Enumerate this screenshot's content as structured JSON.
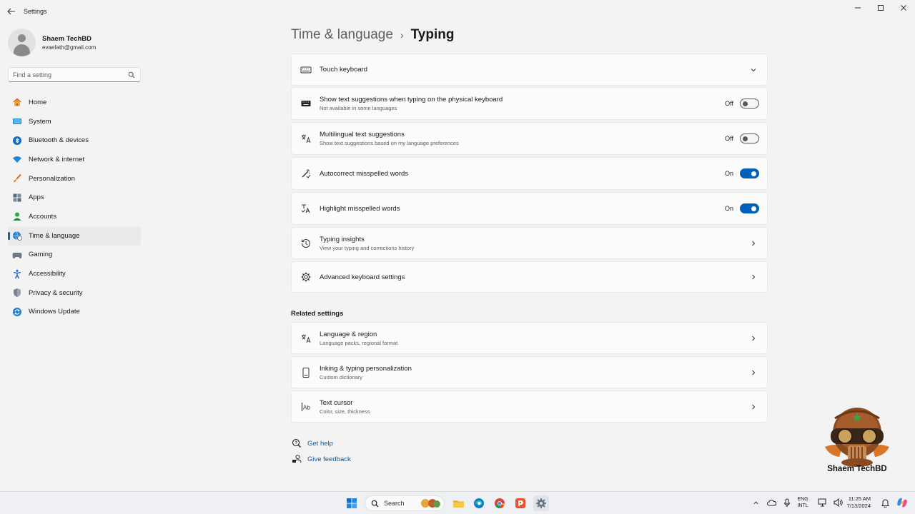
{
  "window": {
    "app_title": "Settings",
    "controls": [
      "minimize-icon",
      "maximize-icon",
      "close-icon"
    ]
  },
  "profile": {
    "name": "Shaem TechBD",
    "email": "evaefath@gmail.com"
  },
  "search": {
    "placeholder": "Find a setting"
  },
  "sidebar": {
    "items": [
      {
        "label": "Home",
        "icon": "home-icon"
      },
      {
        "label": "System",
        "icon": "system-icon"
      },
      {
        "label": "Bluetooth & devices",
        "icon": "bluetooth-icon"
      },
      {
        "label": "Network & internet",
        "icon": "wifi-icon"
      },
      {
        "label": "Personalization",
        "icon": "brush-icon"
      },
      {
        "label": "Apps",
        "icon": "apps-icon"
      },
      {
        "label": "Accounts",
        "icon": "accounts-icon"
      },
      {
        "label": "Time & language",
        "icon": "globe-clock-icon",
        "selected": true
      },
      {
        "label": "Gaming",
        "icon": "gamepad-icon"
      },
      {
        "label": "Accessibility",
        "icon": "accessibility-icon"
      },
      {
        "label": "Privacy & security",
        "icon": "shield-icon"
      },
      {
        "label": "Windows Update",
        "icon": "update-icon"
      }
    ]
  },
  "breadcrumb": {
    "parent": "Time & language",
    "separator": "›",
    "current": "Typing"
  },
  "settings": {
    "touch_keyboard": {
      "title": "Touch keyboard"
    },
    "text_suggestions": {
      "title": "Show text suggestions when typing on the physical keyboard",
      "subtitle": "Not available in some languages",
      "state": "Off",
      "on": false
    },
    "multilingual": {
      "title": "Multilingual text suggestions",
      "subtitle": "Show text suggestions based on my language preferences",
      "state": "Off",
      "on": false
    },
    "autocorrect": {
      "title": "Autocorrect misspelled words",
      "state": "On",
      "on": true
    },
    "highlight": {
      "title": "Highlight misspelled words",
      "state": "On",
      "on": true
    },
    "insights": {
      "title": "Typing insights",
      "subtitle": "View your typing and corrections history"
    },
    "advanced": {
      "title": "Advanced keyboard settings"
    }
  },
  "related": {
    "heading": "Related settings",
    "language_region": {
      "title": "Language & region",
      "subtitle": "Language packs, regional format"
    },
    "inking": {
      "title": "Inking & typing personalization",
      "subtitle": "Custom dictionary"
    },
    "text_cursor": {
      "title": "Text cursor",
      "subtitle": "Color, size, thickness"
    }
  },
  "help": {
    "get_help": "Get help",
    "give_feedback": "Give feedback"
  },
  "watermark": {
    "text": "Shaem TechBD"
  },
  "taskbar": {
    "search_label": "Search",
    "lang_line1": "ENG",
    "lang_line2": "INTL",
    "time": "11:25 AM",
    "date": "7/13/2024"
  },
  "colors": {
    "accent": "#005fb8",
    "background": "#f3f3f3",
    "card": "#fbfbfb"
  }
}
